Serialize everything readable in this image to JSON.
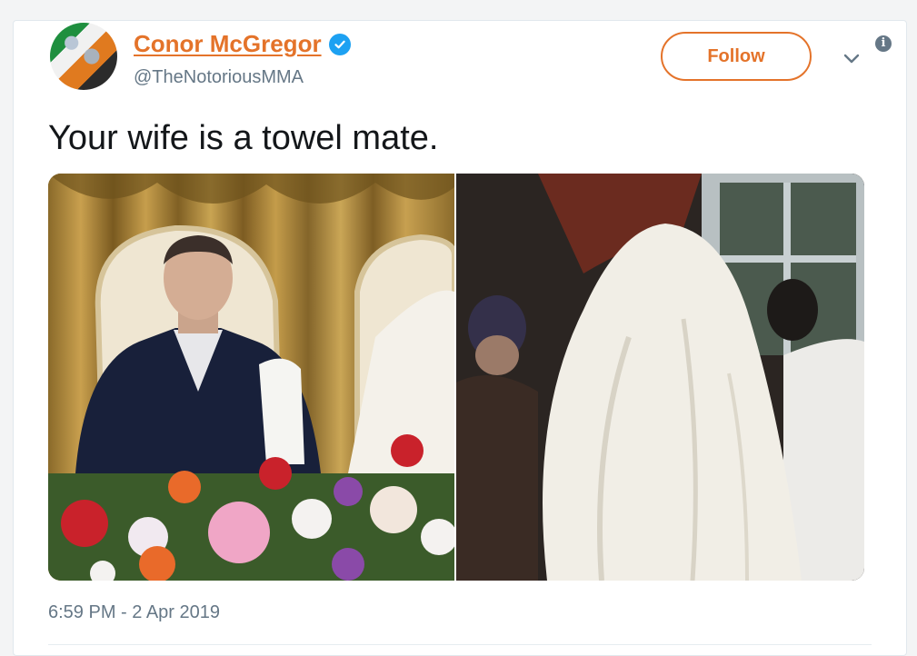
{
  "tweet": {
    "author_name": "Conor McGregor",
    "handle": "@TheNotoriousMMA",
    "follow_label": "Follow",
    "text": "Your wife is a towel mate.",
    "timestamp": "6:59 PM - 2 Apr 2019",
    "icons": {
      "verified": "verified-badge-icon",
      "menu": "chevron-down-icon",
      "info": "info-icon"
    },
    "images": [
      {
        "name": "groom-at-table-photo"
      },
      {
        "name": "veiled-bride-photo"
      }
    ]
  },
  "colors": {
    "accent": "#e4732a",
    "verified": "#1da1f2",
    "muted": "#657786",
    "text": "#14171a"
  }
}
